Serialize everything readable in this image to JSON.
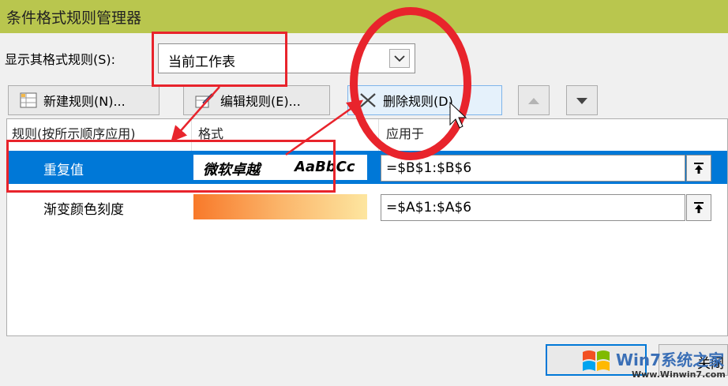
{
  "window": {
    "title": "条件格式规则管理器"
  },
  "scope": {
    "label": "显示其格式规则(S):",
    "value": "当前工作表"
  },
  "toolbar": {
    "new_rule": "新建规则(N)...",
    "edit_rule": "编辑规则(E)...",
    "delete_rule": "删除规则(D)"
  },
  "table": {
    "headers": [
      "规则(按所示顺序应用)",
      "格式",
      "应用于"
    ],
    "rows": [
      {
        "name": "重复值",
        "preview_cn": "微软卓越",
        "preview_en": "AaBbCc",
        "applies_to": "=$B$1:$B$6",
        "selected": true
      },
      {
        "name": "渐变颜色刻度",
        "preview_cn": "",
        "preview_en": "",
        "applies_to": "=$A$1:$A$6",
        "selected": false
      }
    ]
  },
  "footer": {
    "close_label": "关闭"
  },
  "watermark": {
    "text": "Win7系统之家",
    "url": "Www.Winwin7.com"
  },
  "colors": {
    "titlebar": "#b9c64e",
    "selection": "#0078d7",
    "annotation": "#e8242c"
  }
}
